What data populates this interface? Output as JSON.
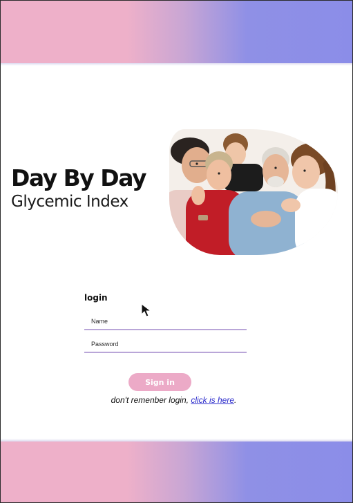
{
  "branding": {
    "title": "Day By Day",
    "subtitle": "Glycemic Index"
  },
  "hero_image": {
    "description_icon": "family-photo"
  },
  "login": {
    "heading": "login",
    "name_placeholder": "Name",
    "password_placeholder": "Password",
    "signin_label": "Sign in",
    "help_prefix": "don't remenber login, ",
    "help_link": "click is here",
    "help_suffix": "."
  },
  "colors": {
    "gradient_pink": "#eeb0c9",
    "gradient_purple": "#8b8de8",
    "button": "#ecaac7",
    "field_underline": "#b9a6d8",
    "link": "#2a2acb"
  }
}
